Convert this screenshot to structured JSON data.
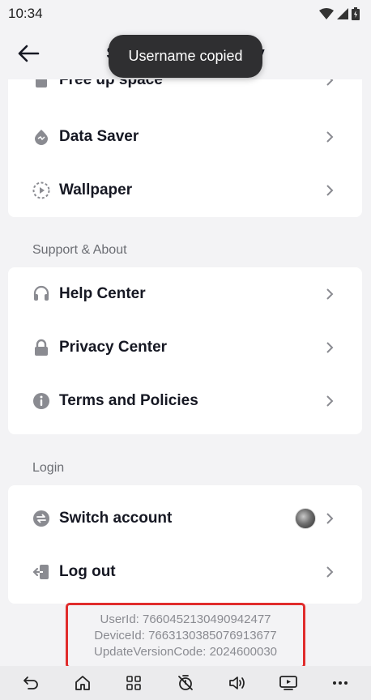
{
  "status_bar": {
    "time": "10:34"
  },
  "header": {
    "title": "Settings and privacy"
  },
  "toast": {
    "text": "Username copied"
  },
  "top_card": {
    "items": [
      {
        "label": "Free up space",
        "icon": "storage-icon"
      },
      {
        "label": "Data Saver",
        "icon": "data-saver-icon"
      },
      {
        "label": "Wallpaper",
        "icon": "wallpaper-icon"
      }
    ]
  },
  "support": {
    "section_title": "Support & About",
    "items": [
      {
        "label": "Help Center",
        "icon": "headset-icon"
      },
      {
        "label": "Privacy Center",
        "icon": "lock-icon"
      },
      {
        "label": "Terms and Policies",
        "icon": "info-icon"
      }
    ]
  },
  "login": {
    "section_title": "Login",
    "items": [
      {
        "label": "Switch account",
        "icon": "switch-icon"
      },
      {
        "label": "Log out",
        "icon": "logout-icon"
      }
    ]
  },
  "device_info": {
    "user_id": "UserId: 7660452130490942477",
    "device_id": "DeviceId: 7663130385076913677",
    "update_version_code": "UpdateVersionCode: 2024600030"
  },
  "colors": {
    "accent_box": "#e02c2c",
    "text_primary": "#161823",
    "text_secondary": "#6b6d73"
  }
}
